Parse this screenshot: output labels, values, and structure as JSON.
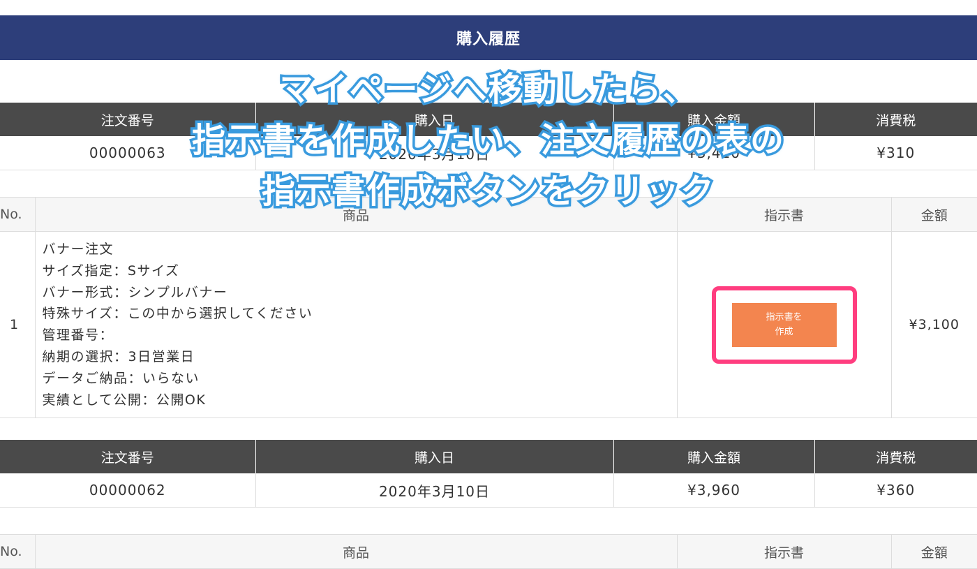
{
  "page_title": "購入履歴",
  "annotation": {
    "lines": [
      "マイページへ移動したら、",
      "指示書を作成したい、注文履歴の表の",
      "指示書作成ボタンをクリック"
    ],
    "fill_color": "#ffffff",
    "outline_color": "#3a9bde"
  },
  "order_headers": {
    "order_no": "注文番号",
    "date": "購入日",
    "amount": "購入金額",
    "tax": "消費税"
  },
  "item_headers": {
    "no": "No.",
    "product": "商品",
    "instructions": "指示書",
    "price": "金額"
  },
  "order1": {
    "order_no": "00000063",
    "date": "2020年3月10日",
    "amount": "¥3,410",
    "tax": "¥310",
    "item": {
      "no": "1",
      "details": [
        "バナー注文",
        "サイズ指定：Sサイズ",
        "バナー形式：シンプルバナー",
        "特殊サイズ：この中から選択してください",
        "管理番号：",
        "納期の選択：3日営業日",
        "データご納品：いらない",
        "実績として公開：公開OK"
      ],
      "button_line1": "指示書を",
      "button_line2": "作成",
      "price": "¥3,100"
    }
  },
  "order2": {
    "order_no": "00000062",
    "date": "2020年3月10日",
    "amount": "¥3,960",
    "tax": "¥360"
  },
  "colors": {
    "title_bar": "#2d3e7a",
    "table_header": "#4a4a4a",
    "button": "#f3854f",
    "highlight_box": "#ff3d7f"
  }
}
